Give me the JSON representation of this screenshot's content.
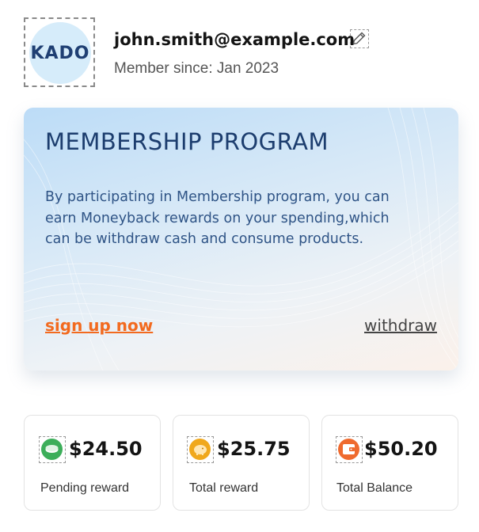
{
  "profile": {
    "avatar_text": "KADO",
    "email": "john.smith@example.com",
    "member_since": "Member since: Jan 2023"
  },
  "card": {
    "title": "MEMBERSHIP PROGRAM",
    "description": "By participating in Membership program, you can earn Moneyback rewards on your spending,which can be withdraw cash and consume products.",
    "signup_label": "sign up now",
    "withdraw_label": "withdraw"
  },
  "stats": [
    {
      "value": "$24.50",
      "label": "Pending reward",
      "icon": "green-coin-icon",
      "color": "#3cae5a"
    },
    {
      "value": "$25.75",
      "label": "Total reward",
      "icon": "piggy-bank-icon",
      "color": "#f0a81c"
    },
    {
      "value": "$50.20",
      "label": "Total Balance",
      "icon": "wallet-icon",
      "color": "#ef6a2e"
    }
  ],
  "colors": {
    "accent_orange": "#f26a1f",
    "title_blue": "#1c3d6e"
  }
}
